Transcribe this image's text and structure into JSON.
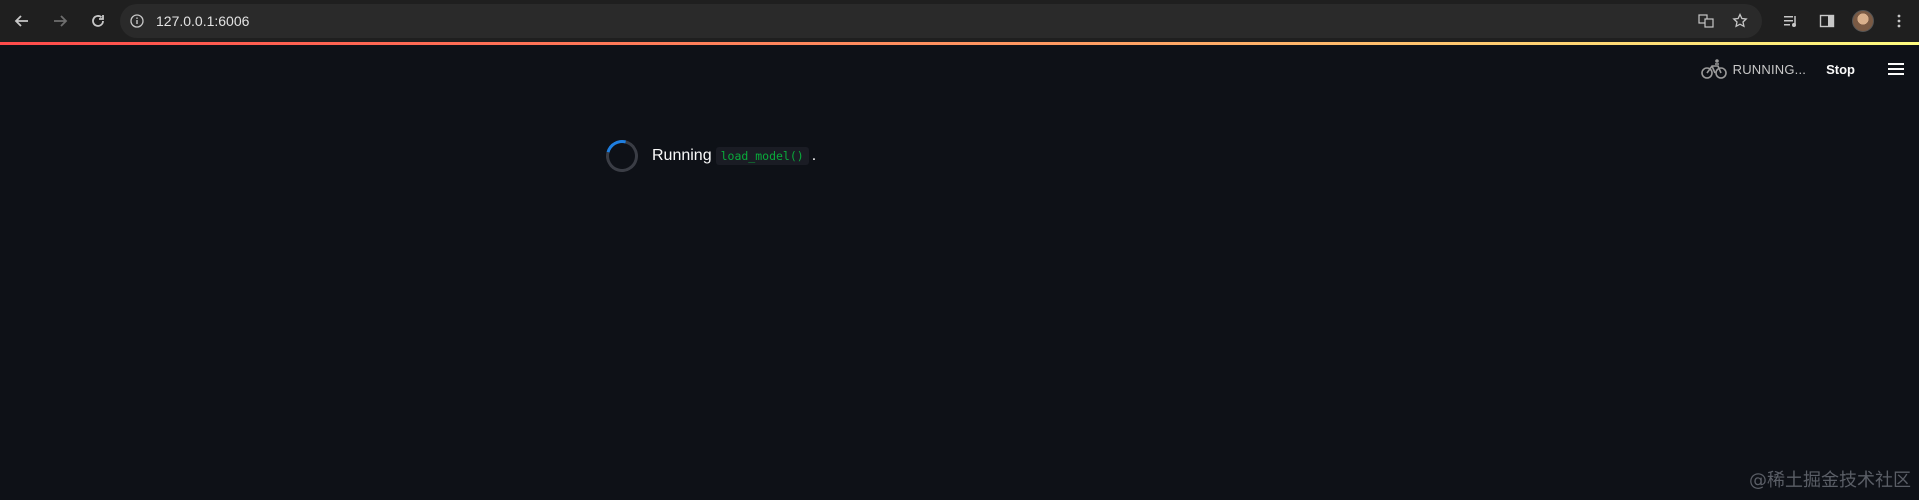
{
  "browser": {
    "url": "127.0.0.1:6006",
    "back_icon": "arrow-left-icon",
    "forward_icon": "arrow-right-icon",
    "reload_icon": "reload-icon"
  },
  "app": {
    "status_text": "RUNNING...",
    "stop_label": "Stop"
  },
  "main": {
    "running_label": "Running",
    "function_name": "load_model()",
    "period": "."
  },
  "watermark": "@稀土掘金技术社区",
  "colors": {
    "background": "#0e1117",
    "accent_red": "#ff4b4b",
    "code_green": "#09ab3b",
    "spinner_blue": "#1f7fe0"
  }
}
